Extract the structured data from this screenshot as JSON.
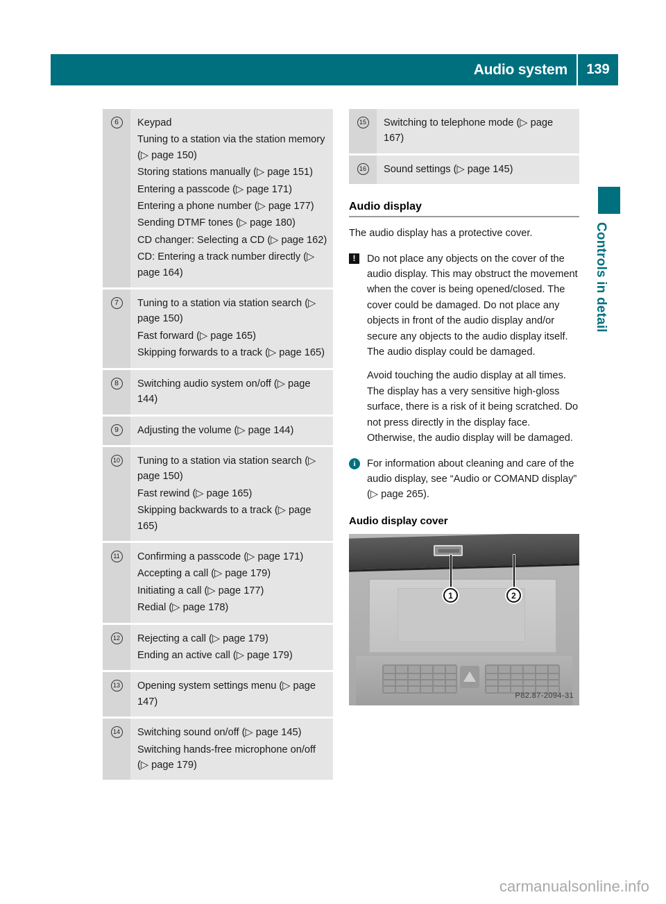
{
  "header": {
    "title": "Audio system",
    "page_number": "139"
  },
  "side_tab": {
    "label": "Controls in detail"
  },
  "left_column": {
    "items": [
      {
        "number": "6",
        "lines": [
          "Keypad",
          "Tuning to a station via the station memory (▷ page 150)",
          "Storing stations manually (▷ page 151)",
          "Entering a passcode (▷ page 171)",
          "Entering a phone number (▷ page 177)",
          "Sending DTMF tones (▷ page 180)",
          "CD changer: Selecting a CD (▷ page 162)",
          "CD: Entering a track number directly (▷ page 164)"
        ]
      },
      {
        "number": "7",
        "lines": [
          "Tuning to a station via station search (▷ page 150)",
          "Fast forward (▷ page 165)",
          "Skipping forwards to a track (▷ page 165)"
        ]
      },
      {
        "number": "8",
        "lines": [
          "Switching audio system on/off (▷ page 144)"
        ]
      },
      {
        "number": "9",
        "lines": [
          "Adjusting the volume (▷ page 144)"
        ]
      },
      {
        "number": "10",
        "lines": [
          "Tuning to a station via station search (▷ page 150)",
          "Fast rewind (▷ page 165)",
          "Skipping backwards to a track (▷ page 165)"
        ]
      },
      {
        "number": "11",
        "lines": [
          "Confirming a passcode (▷ page 171)",
          "Accepting a call (▷ page 179)",
          "Initiating a call (▷ page 177)",
          "Redial (▷ page 178)"
        ]
      },
      {
        "number": "12",
        "lines": [
          "Rejecting a call (▷ page 179)",
          "Ending an active call (▷ page 179)"
        ]
      },
      {
        "number": "13",
        "lines": [
          "Opening system settings menu (▷ page 147)"
        ]
      },
      {
        "number": "14",
        "lines": [
          "Switching sound on/off (▷ page 145)",
          "Switching hands-free microphone on/off (▷ page 179)"
        ]
      }
    ]
  },
  "right_column": {
    "items": [
      {
        "number": "15",
        "lines": [
          "Switching to telephone mode (▷ page 167)"
        ]
      },
      {
        "number": "16",
        "lines": [
          "Sound settings (▷ page 145)"
        ]
      }
    ],
    "heading": "Audio display",
    "intro": "The audio display has a protective cover.",
    "warning": {
      "icon": "warning-icon",
      "paragraph_1": "Do not place any objects on the cover of the audio display. This may obstruct the movement when the cover is being opened/closed. The cover could be damaged. Do not place any objects in front of the audio display and/or secure any objects to the audio display itself. The audio display could be damaged.",
      "paragraph_2": "Avoid touching the audio display at all times. The display has a very sensitive high-gloss surface, there is a risk of it being scratched. Do not press directly in the display face. Otherwise, the audio display will be damaged."
    },
    "info": {
      "icon": "info-icon",
      "text": "For information about cleaning and care of the audio display, see “Audio or COMAND display” (▷ page 265)."
    },
    "subheading": "Audio display cover",
    "figure": {
      "callout_1": "1",
      "callout_2": "2",
      "photo_id": "P82.87-2094-31"
    }
  },
  "watermark": "carmanualsonline.info",
  "colors": {
    "accent_teal": "#00707f",
    "row_number_bg": "#d6d6d6",
    "row_body_bg": "#e5e5e5",
    "text": "#1a1a1a"
  }
}
